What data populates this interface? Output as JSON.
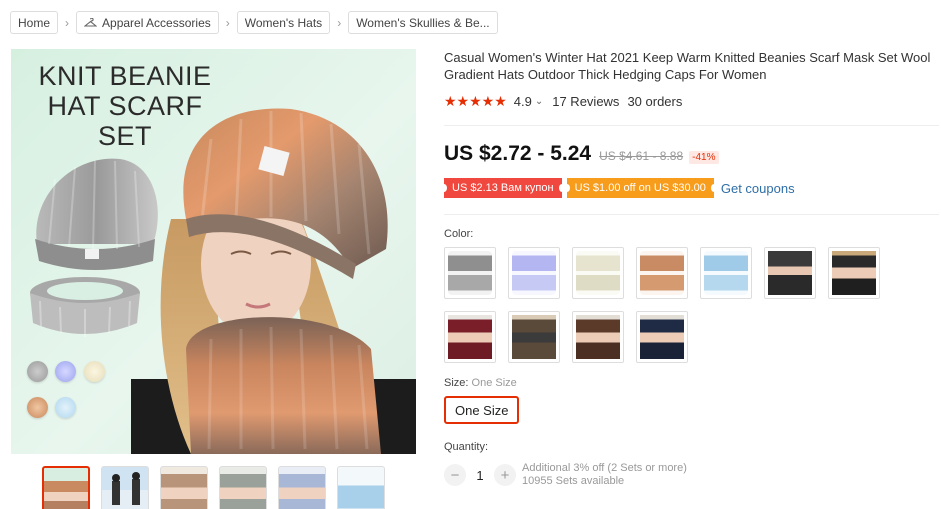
{
  "breadcrumb": {
    "items": [
      "Home",
      "Apparel Accessories",
      "Women's Hats",
      "Women's Skullies & Be..."
    ],
    "separator": "›"
  },
  "gallery": {
    "headline_line1": "KNIT BEANIE",
    "headline_line2": "HAT SCARF SET",
    "thumbnail_count": 6,
    "active_thumbnail": 1
  },
  "product": {
    "title": "Casual Women's Winter Hat 2021 Keep Warm Knitted Beanies Scarf Mask Set Wool Gradient Hats Outdoor Thick Hedging Caps For Women",
    "rating_stars": "★★★★★",
    "rating_value": "4.9",
    "rating_caret": "⌄",
    "reviews": "17 Reviews",
    "orders": "30 orders"
  },
  "pricing": {
    "price": "US $2.72 - 5.24",
    "original_price": "US $4.61 - 8.88",
    "discount": "-41%",
    "coupon_red": "US $2.13 Вам купон",
    "coupon_orange": "US $1.00 off on US $30.00",
    "get_coupons": "Get coupons"
  },
  "options": {
    "color_label": "Color:",
    "size_label": "Size:",
    "size_value": "One Size",
    "size_button": "One Size",
    "quantity_label": "Quantity:"
  },
  "quantity": {
    "minus": "−",
    "value": "1",
    "plus": "+",
    "additional": "Additional 3% off (2 Sets or more)",
    "available": "10955 Sets available"
  },
  "colors": {
    "accent": "#e62e04",
    "price_text": "#111111",
    "link": "#2e6fa7",
    "coupon_red": "#f0483e",
    "coupon_orange": "#f89c1b"
  }
}
